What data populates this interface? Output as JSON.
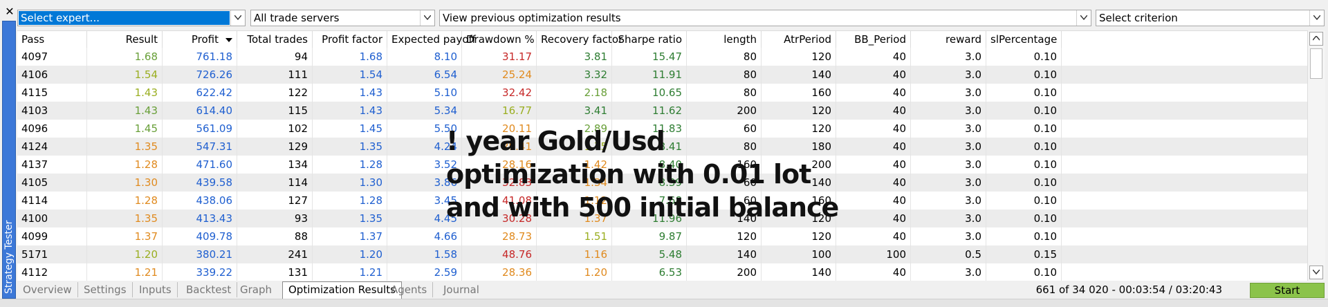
{
  "window": {
    "side_tab_label": "Strategy Tester",
    "close_glyph": "✕"
  },
  "toolbar": {
    "expert": "Select expert...",
    "servers": "All trade servers",
    "optimization": "View previous optimization results",
    "criterion": "Select criterion"
  },
  "columns": [
    "Pass",
    "Result",
    "Profit",
    "Total trades",
    "Profit factor",
    "Expected payoff",
    "Drawdown %",
    "Recovery factor",
    "Sharpe ratio",
    "length",
    "AtrPeriod",
    "BB_Period",
    "reward",
    "slPercentage"
  ],
  "sorted_column": "Profit",
  "sort_direction": "descending",
  "colors": {
    "green": "#2e7d32",
    "lightgreen": "#689f38",
    "olive": "#9aae20",
    "orange": "#e08a1e",
    "red": "#c62828",
    "blue": "#1f5fd0",
    "black": "#000000",
    "accent": "#3c78d8",
    "start": "#8bc34a"
  },
  "rows": [
    {
      "pass": "4097",
      "result": "1.68",
      "profit": "761.18",
      "trades": "94",
      "pf": "1.68",
      "payoff": "8.10",
      "dd": "31.17",
      "rf": "3.81",
      "sharpe": "15.47",
      "length": "80",
      "atr": "120",
      "bb": "40",
      "reward": "3.0",
      "sl": "0.10",
      "rc": "lightgreen",
      "ddc": "red",
      "rfc": "green",
      "sc": "green"
    },
    {
      "pass": "4106",
      "result": "1.54",
      "profit": "726.26",
      "trades": "111",
      "pf": "1.54",
      "payoff": "6.54",
      "dd": "25.24",
      "rf": "3.32",
      "sharpe": "11.91",
      "length": "80",
      "atr": "140",
      "bb": "40",
      "reward": "3.0",
      "sl": "0.10",
      "rc": "olive",
      "ddc": "orange",
      "rfc": "green",
      "sc": "green"
    },
    {
      "pass": "4115",
      "result": "1.43",
      "profit": "622.42",
      "trades": "122",
      "pf": "1.43",
      "payoff": "5.10",
      "dd": "32.42",
      "rf": "2.18",
      "sharpe": "10.65",
      "length": "80",
      "atr": "160",
      "bb": "40",
      "reward": "3.0",
      "sl": "0.10",
      "rc": "olive",
      "ddc": "red",
      "rfc": "lightgreen",
      "sc": "green"
    },
    {
      "pass": "4103",
      "result": "1.43",
      "profit": "614.40",
      "trades": "115",
      "pf": "1.43",
      "payoff": "5.34",
      "dd": "16.77",
      "rf": "3.41",
      "sharpe": "11.62",
      "length": "200",
      "atr": "120",
      "bb": "40",
      "reward": "3.0",
      "sl": "0.10",
      "rc": "lightgreen",
      "ddc": "olive",
      "rfc": "green",
      "sc": "green"
    },
    {
      "pass": "4096",
      "result": "1.45",
      "profit": "561.09",
      "trades": "102",
      "pf": "1.45",
      "payoff": "5.50",
      "dd": "20.11",
      "rf": "2.89",
      "sharpe": "11.83",
      "length": "60",
      "atr": "120",
      "bb": "40",
      "reward": "3.0",
      "sl": "0.10",
      "rc": "lightgreen",
      "ddc": "orange",
      "rfc": "lightgreen",
      "sc": "green"
    },
    {
      "pass": "4124",
      "result": "1.35",
      "profit": "547.31",
      "trades": "129",
      "pf": "1.35",
      "payoff": "4.24",
      "dd": "29.41",
      "rf": "1.75",
      "sharpe": "8.41",
      "length": "80",
      "atr": "180",
      "bb": "40",
      "reward": "3.0",
      "sl": "0.10",
      "rc": "orange",
      "ddc": "orange",
      "rfc": "olive",
      "sc": "green"
    },
    {
      "pass": "4137",
      "result": "1.28",
      "profit": "471.60",
      "trades": "134",
      "pf": "1.28",
      "payoff": "3.52",
      "dd": "28.16",
      "rf": "1.42",
      "sharpe": "8.40",
      "length": "160",
      "atr": "200",
      "bb": "40",
      "reward": "3.0",
      "sl": "0.10",
      "rc": "orange",
      "ddc": "orange",
      "rfc": "orange",
      "sc": "green"
    },
    {
      "pass": "4105",
      "result": "1.30",
      "profit": "439.58",
      "trades": "114",
      "pf": "1.30",
      "payoff": "3.86",
      "dd": "32.83",
      "rf": "1.34",
      "sharpe": "8.39",
      "length": "60",
      "atr": "140",
      "bb": "40",
      "reward": "3.0",
      "sl": "0.10",
      "rc": "orange",
      "ddc": "red",
      "rfc": "orange",
      "sc": "green"
    },
    {
      "pass": "4114",
      "result": "1.28",
      "profit": "438.06",
      "trades": "127",
      "pf": "1.28",
      "payoff": "3.45",
      "dd": "41.08",
      "rf": "1.12",
      "sharpe": "7.68",
      "length": "60",
      "atr": "160",
      "bb": "40",
      "reward": "3.0",
      "sl": "0.10",
      "rc": "orange",
      "ddc": "red",
      "rfc": "orange",
      "sc": "green"
    },
    {
      "pass": "4100",
      "result": "1.35",
      "profit": "413.43",
      "trades": "93",
      "pf": "1.35",
      "payoff": "4.45",
      "dd": "30.28",
      "rf": "1.37",
      "sharpe": "11.96",
      "length": "140",
      "atr": "120",
      "bb": "40",
      "reward": "3.0",
      "sl": "0.10",
      "rc": "orange",
      "ddc": "red",
      "rfc": "orange",
      "sc": "green"
    },
    {
      "pass": "4099",
      "result": "1.37",
      "profit": "409.78",
      "trades": "88",
      "pf": "1.37",
      "payoff": "4.66",
      "dd": "28.73",
      "rf": "1.51",
      "sharpe": "9.87",
      "length": "120",
      "atr": "120",
      "bb": "40",
      "reward": "3.0",
      "sl": "0.10",
      "rc": "orange",
      "ddc": "orange",
      "rfc": "olive",
      "sc": "green"
    },
    {
      "pass": "5171",
      "result": "1.20",
      "profit": "380.21",
      "trades": "241",
      "pf": "1.20",
      "payoff": "1.58",
      "dd": "48.76",
      "rf": "1.16",
      "sharpe": "5.48",
      "length": "140",
      "atr": "100",
      "bb": "100",
      "reward": "0.5",
      "sl": "0.15",
      "rc": "olive",
      "ddc": "red",
      "rfc": "orange",
      "sc": "green"
    },
    {
      "pass": "4112",
      "result": "1.21",
      "profit": "339.22",
      "trades": "131",
      "pf": "1.21",
      "payoff": "2.59",
      "dd": "28.36",
      "rf": "1.20",
      "sharpe": "6.53",
      "length": "200",
      "atr": "140",
      "bb": "40",
      "reward": "3.0",
      "sl": "0.10",
      "rc": "orange",
      "ddc": "orange",
      "rfc": "orange",
      "sc": "green"
    }
  ],
  "tabs": [
    {
      "label": "Overview",
      "active": false
    },
    {
      "label": "Settings",
      "active": false
    },
    {
      "label": "Inputs",
      "active": false
    },
    {
      "label": "Backtest",
      "active": false
    },
    {
      "label": "Graph",
      "active": false
    },
    {
      "label": "Optimization Results",
      "active": true
    },
    {
      "label": "Agents",
      "active": false
    },
    {
      "label": "Journal",
      "active": false
    }
  ],
  "status": {
    "progress": "661 of 34 020  -  00:03:54 / 03:20:43",
    "start_label": "Start"
  },
  "overlay": {
    "lines": [
      "! year Gold/Usd",
      "optimization with 0.01 lot",
      "and with 500 initial balance"
    ]
  }
}
